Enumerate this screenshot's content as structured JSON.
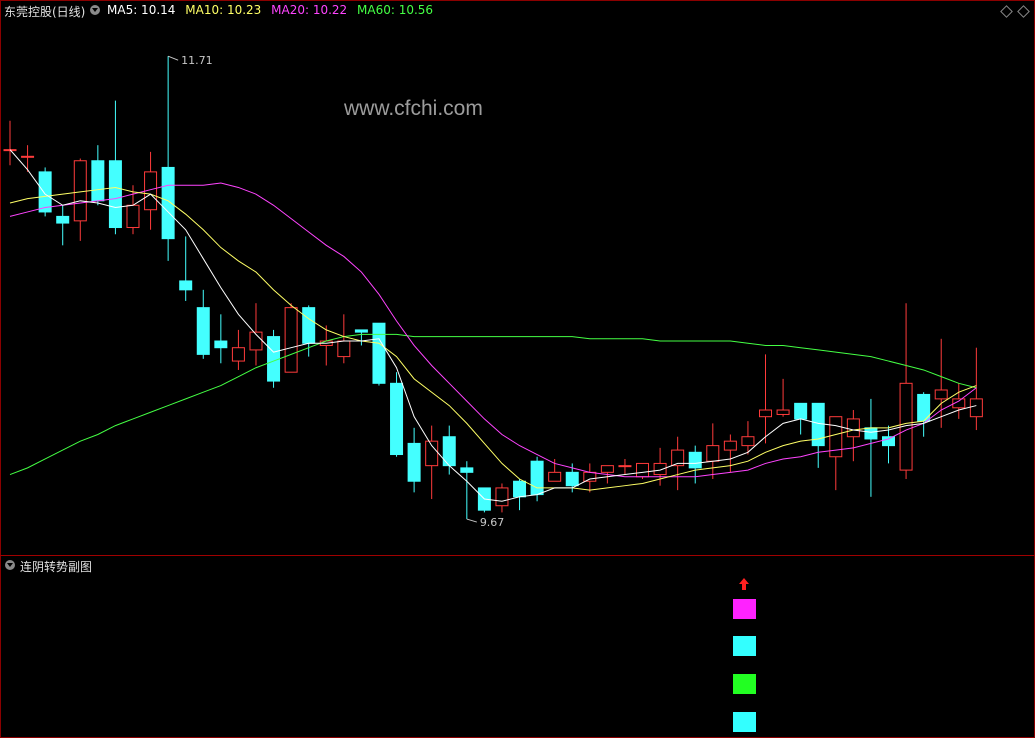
{
  "header": {
    "title": "东莞控股(日线)",
    "ma_legend": [
      {
        "label": "MA5: 10.14",
        "color": "#ffffff"
      },
      {
        "label": "MA10: 10.23",
        "color": "#ffff66"
      },
      {
        "label": "MA20: 10.22",
        "color": "#ff44ff"
      },
      {
        "label": "MA60: 10.56",
        "color": "#44ff44"
      }
    ]
  },
  "watermark": "www.cfchi.com",
  "sub_panel": {
    "title": "连阴转势副图",
    "signals": [
      {
        "type": "arrow",
        "color": "#ff2020"
      },
      {
        "type": "box",
        "color": "#ff22ff"
      },
      {
        "type": "box",
        "color": "#33ffff"
      },
      {
        "type": "box",
        "color": "#22ff22"
      },
      {
        "type": "box",
        "color": "#33ffff"
      }
    ]
  },
  "chart_data": {
    "type": "candlestick",
    "y_range": [
      9.5,
      11.85
    ],
    "high_label": "11.71",
    "low_label": "9.67",
    "colors": {
      "up": "#ff3b3b",
      "down": "#44ffff",
      "ma5": "#ffffff",
      "ma10": "#ffff66",
      "ma20": "#ff44ff",
      "ma60": "#44ff44"
    },
    "candles": [
      [
        11.29,
        11.29,
        11.42,
        11.22
      ],
      [
        11.26,
        11.26,
        11.31,
        11.19
      ],
      [
        11.19,
        11.01,
        11.21,
        10.99
      ],
      [
        10.99,
        10.96,
        11.04,
        10.86
      ],
      [
        10.97,
        11.24,
        11.25,
        10.88
      ],
      [
        11.24,
        11.06,
        11.31,
        11.04
      ],
      [
        11.24,
        10.94,
        11.51,
        10.91
      ],
      [
        10.94,
        11.04,
        11.13,
        10.91
      ],
      [
        11.02,
        11.19,
        11.28,
        10.93
      ],
      [
        11.21,
        10.89,
        11.71,
        10.79
      ],
      [
        10.7,
        10.66,
        10.9,
        10.61
      ],
      [
        10.58,
        10.37,
        10.66,
        10.35
      ],
      [
        10.43,
        10.4,
        10.55,
        10.33
      ],
      [
        10.34,
        10.4,
        10.48,
        10.3
      ],
      [
        10.39,
        10.47,
        10.6,
        10.32
      ],
      [
        10.45,
        10.25,
        10.48,
        10.22
      ],
      [
        10.29,
        10.58,
        10.6,
        10.29
      ],
      [
        10.58,
        10.42,
        10.59,
        10.36
      ],
      [
        10.41,
        10.43,
        10.5,
        10.32
      ],
      [
        10.36,
        10.43,
        10.55,
        10.33
      ],
      [
        10.48,
        10.47,
        10.47,
        10.41
      ],
      [
        10.51,
        10.24,
        10.51,
        10.23
      ],
      [
        10.24,
        9.92,
        10.29,
        9.91
      ],
      [
        9.97,
        9.8,
        10.04,
        9.75
      ],
      [
        9.87,
        9.98,
        10.05,
        9.72
      ],
      [
        10.0,
        9.87,
        10.05,
        9.83
      ],
      [
        9.86,
        9.84,
        9.89,
        9.63
      ],
      [
        9.77,
        9.67,
        9.77,
        9.66
      ],
      [
        9.69,
        9.77,
        9.79,
        9.66
      ],
      [
        9.8,
        9.73,
        9.81,
        9.67
      ],
      [
        9.89,
        9.74,
        9.91,
        9.71
      ],
      [
        9.8,
        9.84,
        9.9,
        9.8
      ],
      [
        9.84,
        9.78,
        9.88,
        9.75
      ],
      [
        9.8,
        9.84,
        9.88,
        9.75
      ],
      [
        9.84,
        9.87,
        9.87,
        9.79
      ],
      [
        9.87,
        9.87,
        9.9,
        9.83
      ],
      [
        9.82,
        9.88,
        9.88,
        9.81
      ],
      [
        9.83,
        9.88,
        9.95,
        9.78
      ],
      [
        9.87,
        9.94,
        10.0,
        9.76
      ],
      [
        9.93,
        9.86,
        9.96,
        9.79
      ],
      [
        9.89,
        9.96,
        10.06,
        9.81
      ],
      [
        9.94,
        9.98,
        10.01,
        9.84
      ],
      [
        9.96,
        10.0,
        10.07,
        9.92
      ],
      [
        10.09,
        10.12,
        10.37,
        9.97
      ],
      [
        10.1,
        10.12,
        10.26,
        10.09
      ],
      [
        10.15,
        10.08,
        10.12,
        10.01
      ],
      [
        10.15,
        9.96,
        10.15,
        9.86
      ],
      [
        9.91,
        10.09,
        10.05,
        9.76
      ],
      [
        10.0,
        10.08,
        10.12,
        9.89
      ],
      [
        10.04,
        9.99,
        10.17,
        9.73
      ],
      [
        10.0,
        9.96,
        10.05,
        9.88
      ],
      [
        9.85,
        10.24,
        10.6,
        9.81
      ],
      [
        10.19,
        10.07,
        10.2,
        10.0
      ],
      [
        10.17,
        10.21,
        10.44,
        10.04
      ],
      [
        10.13,
        10.17,
        10.24,
        10.08
      ],
      [
        10.09,
        10.17,
        10.4,
        10.03
      ]
    ],
    "ma5": [
      11.29,
      11.2,
      11.09,
      11.04,
      11.06,
      11.05,
      11.03,
      11.04,
      11.09,
      11.01,
      10.93,
      10.8,
      10.67,
      10.55,
      10.46,
      10.38,
      10.4,
      10.42,
      10.42,
      10.43,
      10.43,
      10.44,
      10.31,
      10.09,
      9.96,
      9.87,
      9.8,
      9.72,
      9.71,
      9.73,
      9.74,
      9.77,
      9.77,
      9.81,
      9.82,
      9.83,
      9.84,
      9.85,
      9.88,
      9.88,
      9.89,
      9.9,
      9.93,
      10.0,
      10.06,
      10.08,
      10.06,
      10.05,
      10.03,
      10.02,
      10.03,
      10.05,
      10.06,
      10.09,
      10.12,
      10.14
    ],
    "ma10": [
      11.05,
      11.07,
      11.08,
      11.09,
      11.1,
      11.11,
      11.12,
      11.1,
      11.09,
      11.06,
      11.0,
      10.93,
      10.85,
      10.79,
      10.74,
      10.66,
      10.59,
      10.53,
      10.48,
      10.45,
      10.43,
      10.42,
      10.36,
      10.26,
      10.2,
      10.14,
      10.06,
      9.97,
      9.88,
      9.81,
      9.77,
      9.77,
      9.77,
      9.76,
      9.77,
      9.78,
      9.79,
      9.81,
      9.83,
      9.85,
      9.86,
      9.87,
      9.89,
      9.93,
      9.96,
      9.98,
      9.99,
      10.01,
      10.03,
      10.04,
      10.04,
      10.06,
      10.07,
      10.15,
      10.2,
      10.23
    ],
    "ma20": [
      10.99,
      11.01,
      11.03,
      11.04,
      11.05,
      11.06,
      11.07,
      11.09,
      11.11,
      11.13,
      11.13,
      11.13,
      11.14,
      11.12,
      11.09,
      11.04,
      10.98,
      10.92,
      10.86,
      10.81,
      10.74,
      10.64,
      10.52,
      10.41,
      10.32,
      10.24,
      10.16,
      10.08,
      10.01,
      9.96,
      9.92,
      9.88,
      9.86,
      9.84,
      9.83,
      9.82,
      9.82,
      9.82,
      9.82,
      9.82,
      9.83,
      9.84,
      9.85,
      9.88,
      9.9,
      9.91,
      9.93,
      9.94,
      9.95,
      9.97,
      9.99,
      10.03,
      10.06,
      10.12,
      10.16,
      10.22
    ],
    "ma60": [
      9.83,
      9.86,
      9.9,
      9.94,
      9.98,
      10.01,
      10.05,
      10.08,
      10.11,
      10.14,
      10.17,
      10.2,
      10.23,
      10.27,
      10.31,
      10.34,
      10.37,
      10.4,
      10.43,
      10.45,
      10.46,
      10.46,
      10.46,
      10.45,
      10.45,
      10.45,
      10.45,
      10.45,
      10.45,
      10.45,
      10.45,
      10.45,
      10.45,
      10.44,
      10.44,
      10.44,
      10.44,
      10.43,
      10.43,
      10.43,
      10.43,
      10.43,
      10.42,
      10.41,
      10.41,
      10.4,
      10.39,
      10.38,
      10.37,
      10.36,
      10.34,
      10.32,
      10.3,
      10.27,
      10.24,
      10.22
    ]
  }
}
